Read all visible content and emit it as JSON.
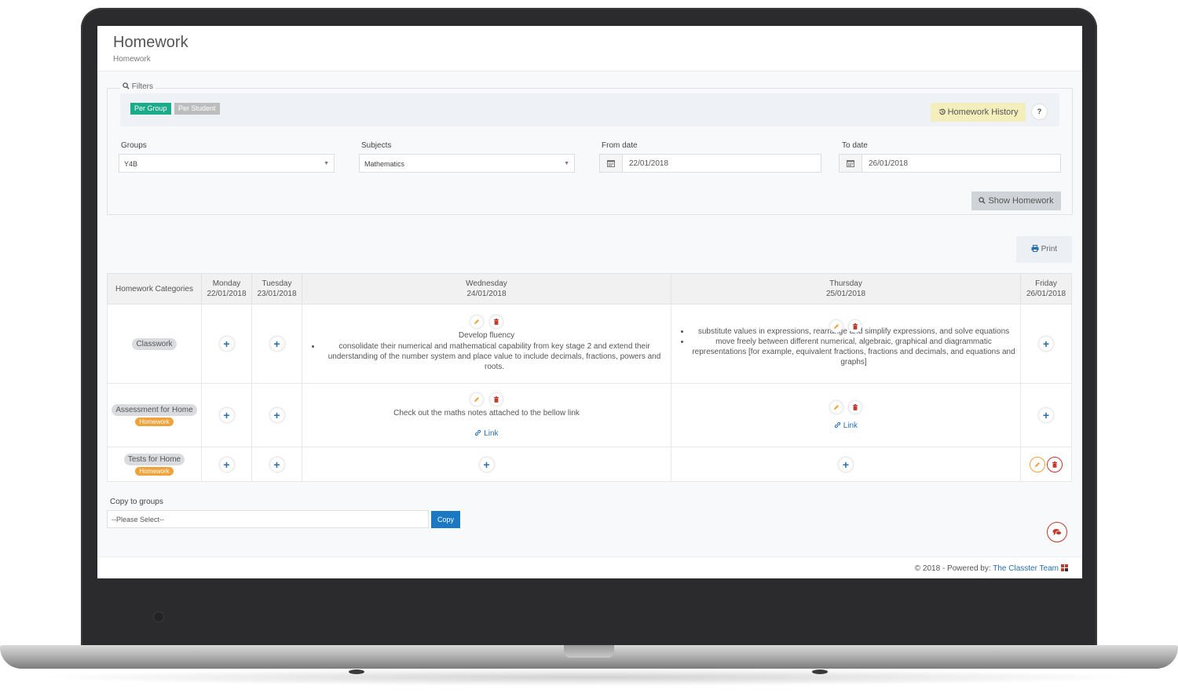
{
  "header": {
    "title": "Homework",
    "breadcrumb": "Homework"
  },
  "filters": {
    "legend": "Filters",
    "tabs": [
      {
        "label": "Per Group",
        "active": true
      },
      {
        "label": "Per Student",
        "active": false
      }
    ],
    "history_button": "Homework History",
    "help_button": "?",
    "groups": {
      "label": "Groups",
      "value": "Y4B"
    },
    "subjects": {
      "label": "Subjects",
      "value": "Mathematics"
    },
    "from_date": {
      "label": "From date",
      "value": "22/01/2018"
    },
    "to_date": {
      "label": "To date",
      "value": "26/01/2018"
    },
    "show_button": "Show Homework"
  },
  "print_button": "Print",
  "table": {
    "columns": [
      {
        "day": "Homework Categories",
        "date": ""
      },
      {
        "day": "Monday",
        "date": "22/01/2018"
      },
      {
        "day": "Tuesday",
        "date": "23/01/2018"
      },
      {
        "day": "Wednesday",
        "date": "24/01/2018"
      },
      {
        "day": "Thursday",
        "date": "25/01/2018"
      },
      {
        "day": "Friday",
        "date": "26/01/2018"
      }
    ],
    "rows": [
      {
        "category": "Classwork",
        "tag": "",
        "wednesday": {
          "title": "Develop fluency",
          "items": [
            "consolidate their numerical and mathematical capability from key stage 2 and extend their understanding of the number system and place value to include decimals, fractions, powers and roots."
          ]
        },
        "thursday": {
          "items": [
            "substitute values in expressions, rearrange and simplify expressions, and solve equations",
            "move freely between different numerical, algebraic, graphical and diagrammatic representations [for example, equivalent fractions, fractions and decimals, and equations and graphs]"
          ]
        }
      },
      {
        "category": "Assessment for Home",
        "tag": "Homework",
        "wednesday": {
          "text": "Check out the maths notes attached to the bellow link",
          "link": "Link"
        },
        "thursday": {
          "link": "Link"
        }
      },
      {
        "category": "Tests for Home",
        "tag": "Homework"
      }
    ]
  },
  "copy": {
    "label": "Copy to groups",
    "placeholder": "--Please Select--",
    "button": "Copy"
  },
  "footer": {
    "text": "© 2018 - Powered by: ",
    "brand": "The Classter Team"
  },
  "colors": {
    "accent_green": "#1aab8a",
    "accent_blue": "#1a79c2",
    "edit_orange": "#f0a23a",
    "delete_red": "#c0392b"
  }
}
